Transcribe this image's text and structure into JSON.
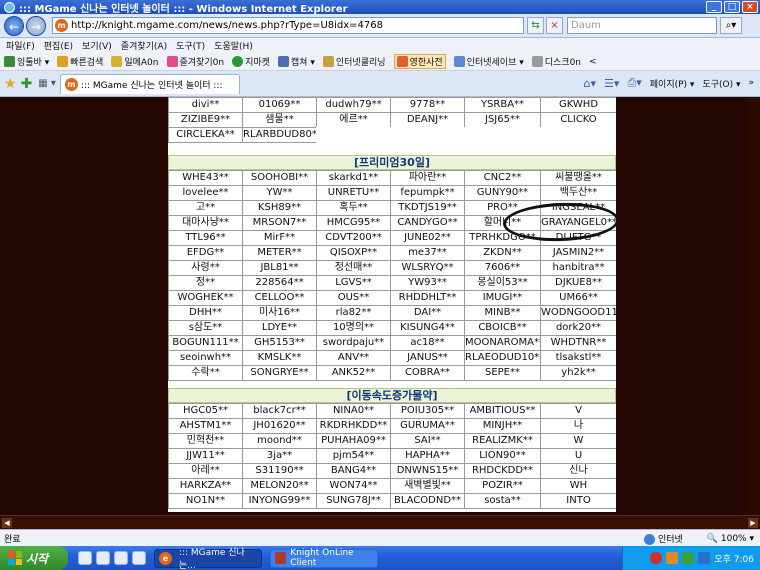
{
  "window": {
    "title": "::: MGame 신나는 인터넷 놀이터 ::: - Windows Internet Explorer"
  },
  "address": {
    "url": "http://knight.mgame.com/news/news.php?rType=U8idx=4768",
    "search_placeholder": "Daum"
  },
  "menu": [
    "파일(F)",
    "편집(E)",
    "보기(V)",
    "즐겨찾기(A)",
    "도구(T)",
    "도움말(H)"
  ],
  "links": [
    "잉툴바 ▾",
    "빠른검색",
    "일메A0n",
    "즐겨찾기0n",
    "지마켓",
    "캡쳐 ▾",
    "인터넷클리닝",
    "영한사전",
    "인터넷세이브 ▾",
    "디스크0n",
    "<"
  ],
  "tab": {
    "label": "::: MGame 신나는 인터넷 놀이터 :::"
  },
  "tab_tools": {
    "page": "페이지(P) ▾",
    "tools": "도구(O) ▾"
  },
  "sections": [
    {
      "title": "",
      "rows": [
        [
          "divi**",
          "01069**",
          "dudwh79**",
          "9778**",
          "YSRBA**",
          "GKWHD"
        ],
        [
          "ZIZIBE9**",
          "샘물**",
          "에르**",
          "DEANJ**",
          "JSJ65**",
          "CLICKO"
        ],
        [
          "CIRCLEKA**",
          "RLARBDUD80**",
          "",
          "",
          "",
          ""
        ]
      ]
    },
    {
      "title": "[프리미엄30일]",
      "rows": [
        [
          "WHE43**",
          "SOOHOBI**",
          "skarkd1**",
          "파아란**",
          "CNC2**",
          "씨불땡올**"
        ],
        [
          "lovelee**",
          "YW**",
          "UNRETU**",
          "fepumpk**",
          "GUNY90**",
          "백두산**"
        ],
        [
          "고**",
          "KSH89**",
          "혹두**",
          "TKDTJS19**",
          "PRO**",
          "INGSEAL**"
        ],
        [
          "대마사냥**",
          "MRSON7**",
          "HMCG95**",
          "CANDYGO**",
          "할머니**",
          "GRAYANGEL0**"
        ],
        [
          "TTL96**",
          "MirF**",
          "CDVT200**",
          "JUNE02**",
          "TPRHKDGO**",
          "DLIFTG**"
        ],
        [
          "EFDG**",
          "METER**",
          "QISOXP**",
          "me37**",
          "ZKDN**",
          "JASMIN2**"
        ],
        [
          "사령**",
          "JBL81**",
          "정선매**",
          "WLSRYQ**",
          "7606**",
          "hanbitra**"
        ],
        [
          "정**",
          "228564**",
          "LGVS**",
          "YW93**",
          "몽실이53**",
          "DJKUE8**"
        ],
        [
          "WOGHEK**",
          "CELLOO**",
          "OUS**",
          "RHDDHLT**",
          "IMUGI**",
          "UM66**"
        ],
        [
          "DHH**",
          "미사16**",
          "rla82**",
          "DAI**",
          "MINB**",
          "WODNGOOD11**"
        ],
        [
          "s삼도**",
          "LDYE**",
          "10명의**",
          "KISUNG4**",
          "CBOICB**",
          "dork20**"
        ],
        [
          "BOGUN111**",
          "GH5153**",
          "swordpaju**",
          "ac18**",
          "MOONAROMA**",
          "WHDTNR**"
        ],
        [
          "seoinwh**",
          "KMSLK**",
          "ANV**",
          "JANUS**",
          "RLAEODUD10**",
          "tlsakstl**"
        ],
        [
          "수락**",
          "SONGRYE**",
          "ANK52**",
          "COBRA**",
          "SEPE**",
          "yh2k**"
        ]
      ]
    },
    {
      "title": "[이동속도증가물약]",
      "rows": [
        [
          "HGC05**",
          "black7cr**",
          "NINA0**",
          "POIU305**",
          "AMBITIOUS**",
          "V"
        ],
        [
          "AHSTM1**",
          "JH01620**",
          "RKDRHKDD**",
          "GURUMA**",
          "MINJH**",
          "나"
        ],
        [
          "민혁천**",
          "moond**",
          "PUHAHA09**",
          "SAI**",
          "REALIZMK**",
          "W"
        ],
        [
          "JJW11**",
          "3ja**",
          "pjm54**",
          "HAPHA**",
          "LION90**",
          "U"
        ],
        [
          "아레**",
          "S31190**",
          "BANG4**",
          "DNWNS15**",
          "RHDCKDD**",
          "신나"
        ],
        [
          "HARKZA**",
          "MELON20**",
          "WON74**",
          "새벽별빛**",
          "POZIR**",
          "WH"
        ],
        [
          "NO1N**",
          "INYONG99**",
          "SUNG78J**",
          "BLACODND**",
          "sosta**",
          "INTO"
        ]
      ]
    }
  ],
  "status": {
    "left": "완료",
    "zone": "인터넷",
    "zoom": "100%"
  },
  "taskbar": {
    "start": "시작",
    "tasks": [
      "::: MGame 신나는...",
      "Knight OnLine Client"
    ],
    "clock": "오후 7:06"
  }
}
